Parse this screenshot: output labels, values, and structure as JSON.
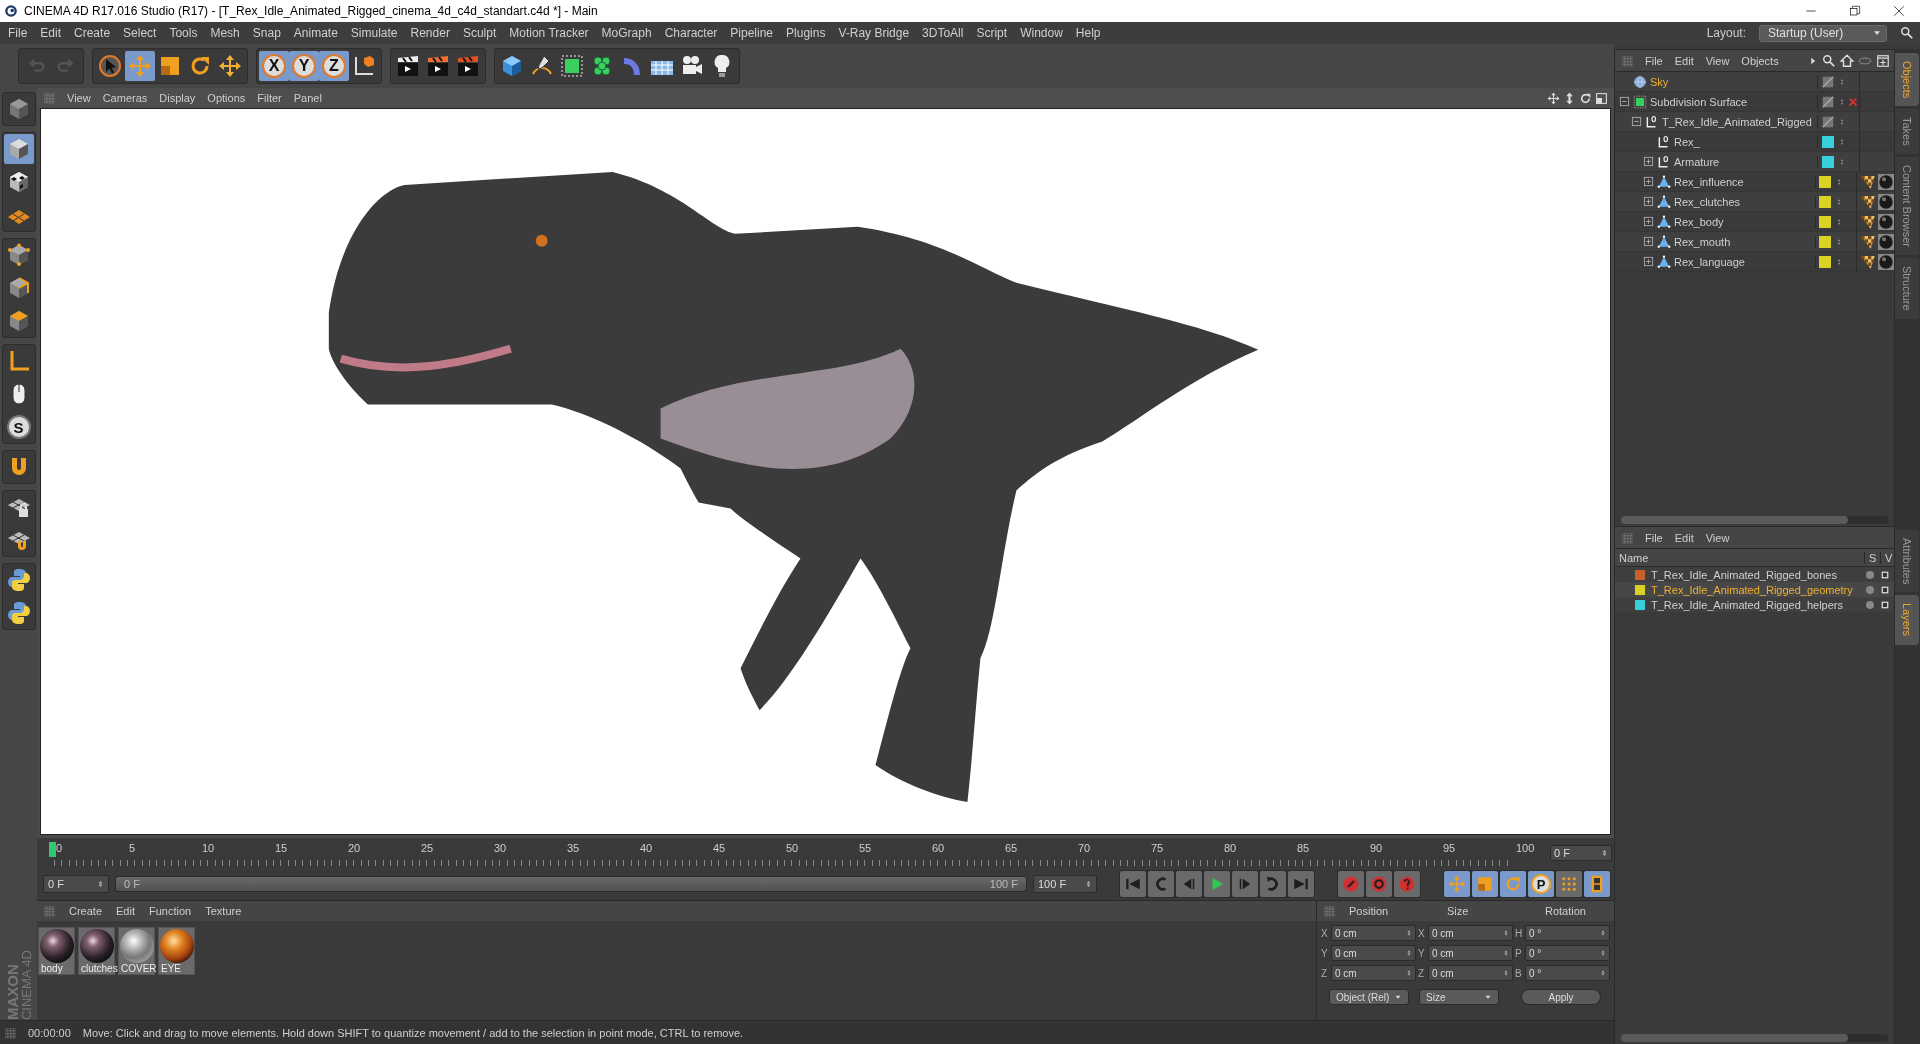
{
  "window": {
    "title": "CINEMA 4D R17.016 Studio (R17) - [T_Rex_Idle_Animated_Rigged_cinema_4d_c4d_standart.c4d *] - Main"
  },
  "menu_bar": [
    "File",
    "Edit",
    "Create",
    "Select",
    "Tools",
    "Mesh",
    "Snap",
    "Animate",
    "Simulate",
    "Render",
    "Sculpt",
    "Motion Tracker",
    "MoGraph",
    "Character",
    "Pipeline",
    "Plugins",
    "V-Ray Bridge",
    "3DToAll",
    "Script",
    "Window",
    "Help"
  ],
  "layout": {
    "label": "Layout:",
    "value": "Startup (User)"
  },
  "toolbar": {
    "history": [
      {
        "kind": "undo",
        "disabled": true
      },
      {
        "kind": "redo",
        "disabled": true
      }
    ],
    "groups": [
      [
        {
          "kind": "select",
          "selected": false
        },
        {
          "kind": "move",
          "selected": true
        },
        {
          "kind": "scale",
          "selected": false
        },
        {
          "kind": "rotate",
          "selected": false
        },
        {
          "kind": "live",
          "selected": false
        }
      ],
      [
        {
          "kind": "axis",
          "label": "X",
          "selected": true
        },
        {
          "kind": "axis",
          "label": "Y",
          "selected": true
        },
        {
          "kind": "axis",
          "label": "Z",
          "selected": true
        },
        {
          "kind": "coord",
          "selected": false
        }
      ],
      [
        {
          "kind": "render-view",
          "selected": false
        },
        {
          "kind": "render-picture",
          "selected": false
        },
        {
          "kind": "render-settings",
          "selected": false
        }
      ],
      [
        {
          "kind": "cube",
          "selected": false
        },
        {
          "kind": "pen",
          "selected": false
        },
        {
          "kind": "subdivision",
          "selected": false
        },
        {
          "kind": "cloner",
          "selected": false
        },
        {
          "kind": "deformer",
          "selected": false
        },
        {
          "kind": "floor",
          "selected": false
        },
        {
          "kind": "camera",
          "selected": false
        },
        {
          "kind": "light",
          "selected": false
        }
      ]
    ]
  },
  "left_toolbar": [
    [
      {
        "kind": "editable",
        "selected": false
      }
    ],
    [
      {
        "kind": "model",
        "selected": true
      },
      {
        "kind": "texture",
        "selected": false
      },
      {
        "kind": "workplane",
        "selected": false
      }
    ],
    [
      {
        "kind": "points",
        "selected": false
      },
      {
        "kind": "edges",
        "selected": false
      },
      {
        "kind": "polygons",
        "selected": false
      }
    ],
    [
      {
        "kind": "axis-mode",
        "selected": false
      },
      {
        "kind": "tweak",
        "selected": false
      },
      {
        "kind": "solo",
        "label": "S",
        "selected": false
      }
    ],
    [
      {
        "kind": "magnet",
        "selected": false
      }
    ],
    [
      {
        "kind": "lock-grid",
        "selected": false
      },
      {
        "kind": "snap-grid",
        "selected": false
      }
    ],
    [
      {
        "kind": "python",
        "selected": false
      },
      {
        "kind": "python",
        "selected": false
      }
    ]
  ],
  "brand": {
    "company": "MAXON",
    "product": "CINEMA 4D"
  },
  "viewport": {
    "menu": [
      "View",
      "Cameras",
      "Display",
      "Options",
      "Filter",
      "Panel"
    ]
  },
  "timeline": {
    "ticks": [
      "0",
      "5",
      "10",
      "15",
      "20",
      "25",
      "30",
      "35",
      "40",
      "45",
      "50",
      "55",
      "60",
      "65",
      "70",
      "75",
      "80",
      "85",
      "90",
      "95",
      "100"
    ],
    "current_frame": "0 F"
  },
  "anim": {
    "start_field": "0 F",
    "range": {
      "start": "0 F",
      "end": "100 F",
      "level": 1
    },
    "end_field": "100 F",
    "transport": [
      {
        "kind": "first"
      },
      {
        "kind": "prev-key"
      },
      {
        "kind": "prev-frame"
      },
      {
        "kind": "play"
      },
      {
        "kind": "next-frame"
      },
      {
        "kind": "next-key"
      },
      {
        "kind": "last"
      }
    ],
    "record": [
      {
        "kind": "record"
      },
      {
        "kind": "autokey"
      },
      {
        "kind": "keysel"
      }
    ],
    "key_tracks": [
      {
        "kind": "move",
        "selected": true
      },
      {
        "kind": "scale",
        "selected": true
      },
      {
        "kind": "rotate",
        "selected": true
      },
      {
        "kind": "param",
        "label": "P",
        "selected": true
      },
      {
        "kind": "pla",
        "selected": false
      },
      {
        "kind": "film",
        "selected": true
      }
    ]
  },
  "materials": {
    "menu": [
      "Create",
      "Edit",
      "Function",
      "Texture"
    ],
    "items": [
      {
        "name": "body",
        "kind": "skin"
      },
      {
        "name": "clutches",
        "kind": "skin"
      },
      {
        "name": "COVER",
        "kind": "chrome"
      },
      {
        "name": "EYE",
        "kind": "eye"
      }
    ]
  },
  "coordinates": {
    "columns": [
      "Position",
      "Size",
      "Rotation"
    ],
    "rows": [
      {
        "axis": "X",
        "position": "0 cm",
        "size_axis": "X",
        "size": "0 cm",
        "rotation_axis": "H",
        "rotation": "0 °"
      },
      {
        "axis": "Y",
        "position": "0 cm",
        "size_axis": "Y",
        "size": "0 cm",
        "rotation_axis": "P",
        "rotation": "0 °"
      },
      {
        "axis": "Z",
        "position": "0 cm",
        "size_axis": "Z",
        "size": "0 cm",
        "rotation_axis": "B",
        "rotation": "0 °"
      }
    ],
    "coordinate_mode": "Object (Rel)",
    "size_mode": "Size",
    "apply": "Apply"
  },
  "status_bar": {
    "time": "00:00:00",
    "message": "Move: Click and drag to move elements. Hold down SHIFT to quantize movement / add to the selection in point mode, CTRL to remove."
  },
  "objects_panel": {
    "menu": [
      "File",
      "Edit",
      "View",
      "Objects"
    ],
    "tree": [
      {
        "name": "Sky",
        "kind": "sky",
        "selected": true,
        "enabled": true
      },
      {
        "name": "Subdivision Surface",
        "kind": "subdivision",
        "selected": false,
        "expanded": true,
        "enabled": false,
        "children": [
          {
            "name": "T_Rex_Idle_Animated_Rigged",
            "kind": "null",
            "selected": false,
            "expanded": true,
            "enabled": true,
            "children": [
              {
                "name": "Rex_",
                "kind": "null",
                "color": "#38d0dc",
                "selected": false,
                "enabled": true
              },
              {
                "name": "Armature",
                "kind": "null",
                "color": "#38d0dc",
                "selected": false,
                "expanded": false,
                "enabled": true
              },
              {
                "name": "Rex_influence",
                "kind": "polygon",
                "color": "#dcd224",
                "selected": false,
                "expanded": false,
                "enabled": true,
                "tags": [
                  {
                    "kind": "weight"
                  },
                  {
                    "kind": "material"
                  }
                ]
              },
              {
                "name": "Rex_clutches",
                "kind": "polygon",
                "color": "#dcd224",
                "selected": false,
                "expanded": false,
                "enabled": true,
                "tags": [
                  {
                    "kind": "weight"
                  },
                  {
                    "kind": "material"
                  }
                ]
              },
              {
                "name": "Rex_body",
                "kind": "polygon",
                "color": "#dcd224",
                "selected": false,
                "expanded": false,
                "enabled": true,
                "tags": [
                  {
                    "kind": "weight"
                  },
                  {
                    "kind": "material"
                  }
                ]
              },
              {
                "name": "Rex_mouth",
                "kind": "polygon",
                "color": "#dcd224",
                "selected": false,
                "expanded": false,
                "enabled": true,
                "tags": [
                  {
                    "kind": "weight"
                  },
                  {
                    "kind": "material"
                  }
                ]
              },
              {
                "name": "Rex_language",
                "kind": "polygon",
                "color": "#dcd224",
                "selected": false,
                "expanded": false,
                "enabled": true,
                "tags": [
                  {
                    "kind": "weight"
                  },
                  {
                    "kind": "material"
                  }
                ]
              }
            ]
          }
        ]
      }
    ]
  },
  "layers_panel": {
    "menu": [
      "File",
      "Edit",
      "View"
    ],
    "columns": [
      "Name",
      "S",
      "V"
    ],
    "layers": [
      {
        "name": "T_Rex_Idle_Animated_Rigged_bones",
        "color": "#c8602c",
        "selected": false
      },
      {
        "name": "T_Rex_Idle_Animated_Rigged_geometry",
        "color": "#dcd224",
        "selected": true
      },
      {
        "name": "T_Rex_Idle_Animated_Rigged_helpers",
        "color": "#38d0dc",
        "selected": false
      }
    ]
  },
  "side_tabs": [
    {
      "label": "Objects",
      "selected": true
    },
    {
      "label": "Takes",
      "selected": false
    },
    {
      "label": "Content Browser",
      "selected": false
    },
    {
      "label": "Structure",
      "selected": false
    }
  ],
  "side_tabs_lower": [
    {
      "label": "Attributes",
      "selected": false
    },
    {
      "label": "Layers",
      "selected": true
    }
  ]
}
